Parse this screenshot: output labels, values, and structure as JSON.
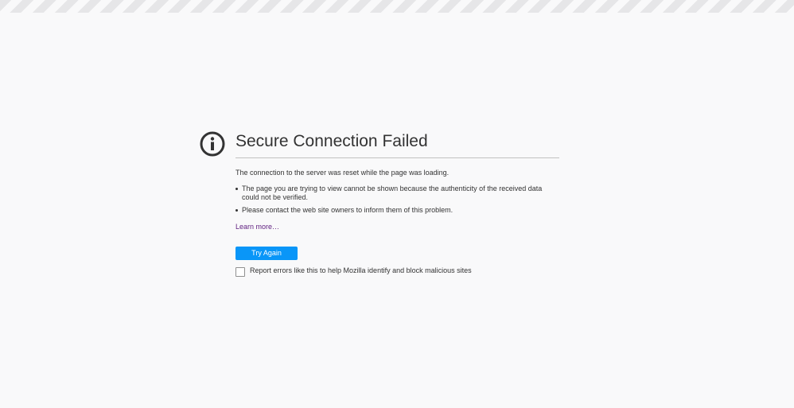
{
  "page": {
    "title": "Secure Connection Failed",
    "short_description": "The connection to the server was reset while the page was loading.",
    "bullets": [
      "The page you are trying to view cannot be shown because the authenticity of the received data could not be verified.",
      "Please contact the web site owners to inform them of this problem."
    ],
    "learn_more": "Learn more…",
    "try_again_label": "Try Again",
    "report_label": "Report errors like this to help Mozilla identify and block malicious sites",
    "report_checked": false
  },
  "icons": {
    "info": "info-circle-icon"
  },
  "colors": {
    "background": "#f9f9fa",
    "accent": "#0996f8",
    "link": "#5f1e7f",
    "text": "#333333"
  }
}
